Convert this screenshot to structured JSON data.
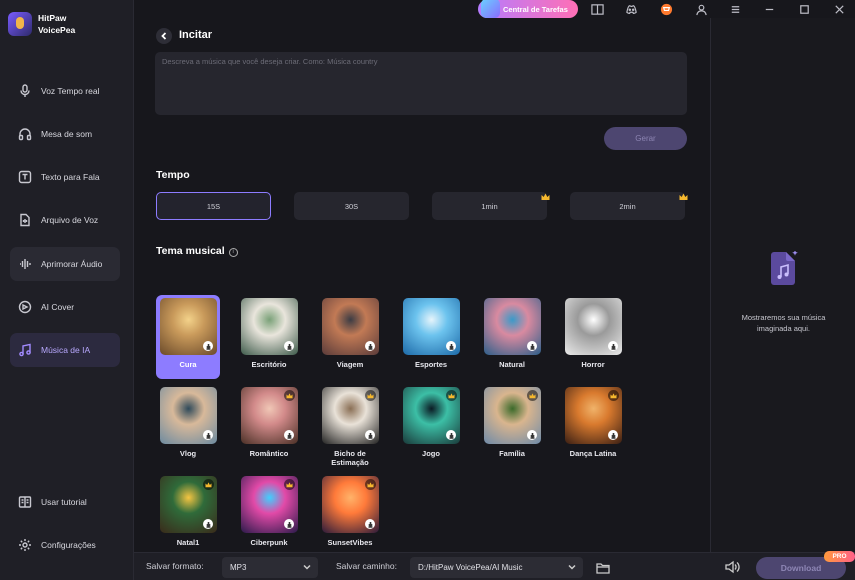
{
  "app": {
    "name_line1": "HitPaw",
    "name_line2": "VoicePea"
  },
  "sidebar": {
    "items": [
      {
        "label": "Voz Tempo real",
        "icon": "microphone-icon"
      },
      {
        "label": "Mesa de som",
        "icon": "headphones-icon"
      },
      {
        "label": "Texto para Fala",
        "icon": "text-to-speech-icon"
      },
      {
        "label": "Arquivo de Voz",
        "icon": "voice-file-icon"
      },
      {
        "label": "Aprimorar Áudio",
        "icon": "audio-enhance-icon"
      },
      {
        "label": "AI Cover",
        "icon": "ai-cover-icon"
      },
      {
        "label": "Música de IA",
        "icon": "ai-music-icon"
      }
    ],
    "bottom_items": [
      {
        "label": "Usar tutorial",
        "icon": "tutorial-icon"
      },
      {
        "label": "Configurações",
        "icon": "settings-gear-icon"
      }
    ]
  },
  "titlebar": {
    "task_center_label": "Central de Tarefas"
  },
  "main": {
    "heading": "Incitar",
    "prompt_placeholder": "Descreva a música que você deseja criar. Como: Música country",
    "generate_label": "Gerar",
    "tempo_title": "Tempo",
    "durations": [
      {
        "label": "15S",
        "selected": true,
        "premium": false
      },
      {
        "label": "30S",
        "selected": false,
        "premium": false
      },
      {
        "label": "1min",
        "selected": false,
        "premium": true
      },
      {
        "label": "2min",
        "selected": false,
        "premium": true
      }
    ],
    "theme_title": "Tema musical",
    "themes": [
      {
        "label": "Cura",
        "selected": true,
        "premium": false
      },
      {
        "label": "Escritório",
        "selected": false,
        "premium": false
      },
      {
        "label": "Viagem",
        "selected": false,
        "premium": false
      },
      {
        "label": "Esportes",
        "selected": false,
        "premium": false
      },
      {
        "label": "Natural",
        "selected": false,
        "premium": false
      },
      {
        "label": "Horror",
        "selected": false,
        "premium": false
      },
      {
        "label": "Vlog",
        "selected": false,
        "premium": false
      },
      {
        "label": "Romântico",
        "selected": false,
        "premium": true
      },
      {
        "label": "Bicho de Estimação",
        "selected": false,
        "premium": true
      },
      {
        "label": "Jogo",
        "selected": false,
        "premium": true
      },
      {
        "label": "Família",
        "selected": false,
        "premium": true
      },
      {
        "label": "Dança Latina",
        "selected": false,
        "premium": true
      },
      {
        "label": "Natal1",
        "selected": false,
        "premium": true
      },
      {
        "label": "Ciberpunk",
        "selected": false,
        "premium": true
      },
      {
        "label": "SunsetVibes",
        "selected": false,
        "premium": true
      }
    ]
  },
  "right_panel": {
    "line1": "Mostraremos sua música",
    "line2": "imaginada aqui."
  },
  "bottom_bar": {
    "format_label": "Salvar formato:",
    "format_value": "MP3",
    "path_label": "Salvar caminho:",
    "path_value": "D:/HitPaw VoicePea/AI Music",
    "download_label": "Download",
    "pro_badge": "PRO"
  },
  "colors": {
    "accent": "#8d7cff",
    "background": "#17171c",
    "sidebar": "#1f1f26",
    "premium_crown": "#f5b82e"
  }
}
